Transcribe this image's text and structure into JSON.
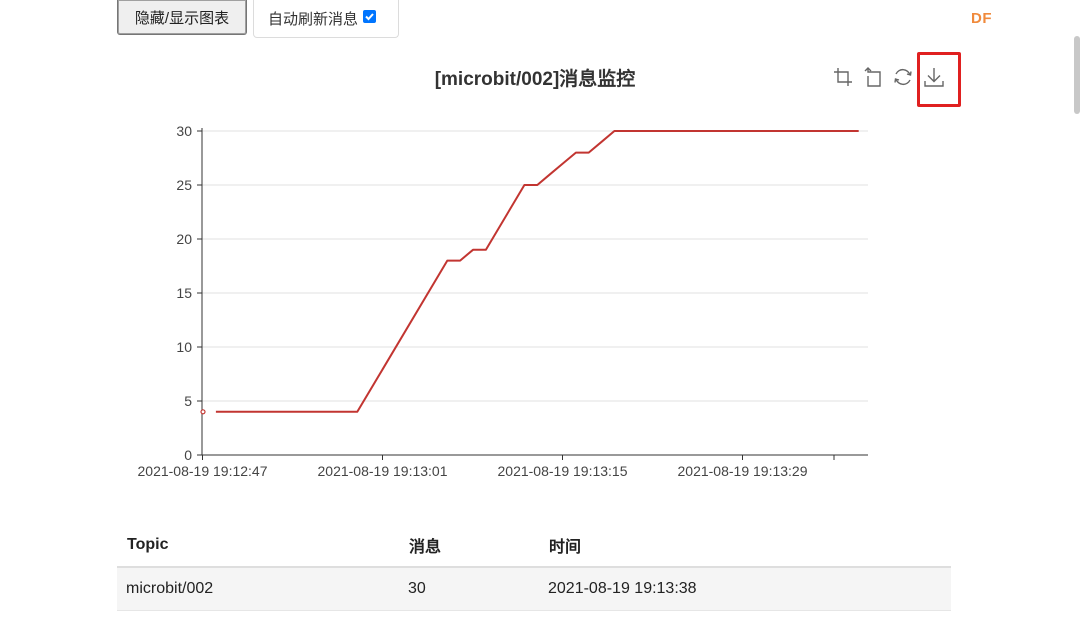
{
  "controls": {
    "toggle_chart_label": "隐藏/显示图表",
    "auto_refresh_label": "自动刷新消息",
    "auto_refresh_checked": true
  },
  "logo_text": "DF",
  "chart": {
    "toolbox_icons": [
      "crop-zoom-icon",
      "zoom-reset-icon",
      "restore-icon",
      "download-icon"
    ],
    "highlighted_tool": "download-icon",
    "line_color": "#c23531"
  },
  "chart_data": {
    "type": "line",
    "title": "[microbit/002]消息监控",
    "xlabel": "",
    "ylabel": "",
    "ylim": [
      0,
      30
    ],
    "yticks": [
      0,
      5,
      10,
      15,
      20,
      25,
      30
    ],
    "xticks": [
      "2021-08-19 19:12:47",
      "2021-08-19 19:13:01",
      "2021-08-19 19:13:15",
      "2021-08-19 19:13:29"
    ],
    "grid": true,
    "series": [
      {
        "x": [
          "2021-08-19 19:12:47",
          "2021-08-19 19:12:48",
          "2021-08-19 19:12:59",
          "2021-08-19 19:13:06",
          "2021-08-19 19:13:07",
          "2021-08-19 19:13:08",
          "2021-08-19 19:13:09",
          "2021-08-19 19:13:12",
          "2021-08-19 19:13:13",
          "2021-08-19 19:13:14",
          "2021-08-19 19:13:15",
          "2021-08-19 19:13:16",
          "2021-08-19 19:13:17",
          "2021-08-19 19:13:18",
          "2021-08-19 19:13:19",
          "2021-08-19 19:13:38"
        ],
        "values": [
          4,
          4,
          4,
          18,
          18,
          19,
          19,
          25,
          25,
          26,
          27,
          28,
          28,
          29,
          30,
          30
        ]
      }
    ]
  },
  "table": {
    "headers": [
      "Topic",
      "消息",
      "时间"
    ],
    "rows": [
      [
        "microbit/002",
        "30",
        "2021-08-19 19:13:38"
      ]
    ]
  }
}
